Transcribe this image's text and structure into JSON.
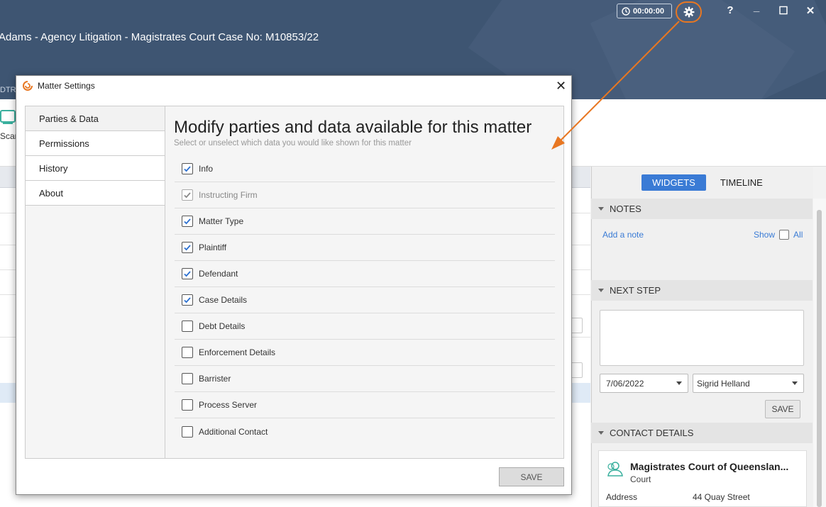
{
  "header": {
    "timer": "00:00:00",
    "title": "Adams - Agency Litigation - Magistrates Court Case No: M10853/22",
    "tab_fragment": "DTRA",
    "window_controls": {
      "help": "?",
      "minimize": "_",
      "maximize": "☐",
      "close": "✕"
    }
  },
  "toolbar": {
    "scan_label": "Scan"
  },
  "right_panel": {
    "tabs": {
      "widgets": "WIDGETS",
      "timeline": "TIMELINE"
    },
    "notes": {
      "header": "NOTES",
      "add_note": "Add a note",
      "show": "Show",
      "all": "All"
    },
    "next_step": {
      "header": "NEXT STEP",
      "date": "7/06/2022",
      "assignee": "Sigrid Helland",
      "save": "SAVE"
    },
    "contact_details": {
      "header": "CONTACT DETAILS",
      "name": "Magistrates Court of Queenslan...",
      "type": "Court",
      "address_label": "Address",
      "address_value": "44 Quay Street"
    }
  },
  "dialog": {
    "title": "Matter Settings",
    "close": "✕",
    "nav": [
      "Parties & Data",
      "Permissions",
      "History",
      "About"
    ],
    "heading": "Modify parties and data available for this matter",
    "subheading": "Select or unselect which data you would like shown for this matter",
    "items": [
      {
        "label": "Info",
        "checked": true,
        "disabled": false
      },
      {
        "label": "Instructing Firm",
        "checked": true,
        "disabled": true
      },
      {
        "label": "Matter Type",
        "checked": true,
        "disabled": false
      },
      {
        "label": "Plaintiff",
        "checked": true,
        "disabled": false
      },
      {
        "label": "Defendant",
        "checked": true,
        "disabled": false
      },
      {
        "label": "Case Details",
        "checked": true,
        "disabled": false
      },
      {
        "label": "Debt Details",
        "checked": false,
        "disabled": false
      },
      {
        "label": "Enforcement Details",
        "checked": false,
        "disabled": false
      },
      {
        "label": "Barrister",
        "checked": false,
        "disabled": false
      },
      {
        "label": "Process Server",
        "checked": false,
        "disabled": false
      },
      {
        "label": "Additional Contact",
        "checked": false,
        "disabled": false
      }
    ],
    "save": "SAVE"
  },
  "colors": {
    "header_bg": "#3e5572",
    "accent": "#3a7bd5",
    "highlight": "#e87722"
  }
}
